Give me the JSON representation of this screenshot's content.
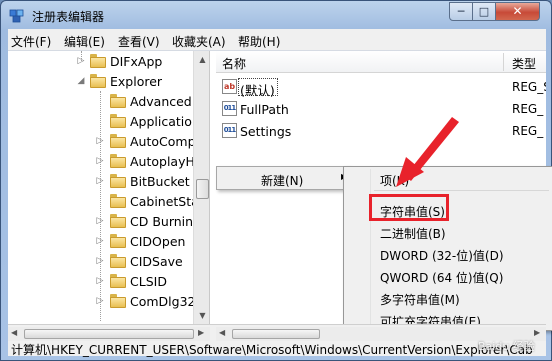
{
  "window": {
    "title": "注册表编辑器",
    "controls": {
      "minimize": "─",
      "maximize": "□",
      "close": "✕"
    }
  },
  "menu": [
    "文件(F)",
    "编辑(E)",
    "查看(V)",
    "收藏夹(A)",
    "帮助(H)"
  ],
  "tree": {
    "items": [
      {
        "label": "DIFxApp",
        "expandable": true
      },
      {
        "label": "Explorer",
        "expandable": true,
        "expanded": true
      },
      {
        "label": "Advanced",
        "expandable": false
      },
      {
        "label": "Application",
        "expandable": false
      },
      {
        "label": "AutoComp",
        "expandable": true
      },
      {
        "label": "AutoplayHa",
        "expandable": true
      },
      {
        "label": "BitBucket",
        "expandable": true
      },
      {
        "label": "CabinetSta",
        "expandable": false,
        "selected": true
      },
      {
        "label": "CD Burning",
        "expandable": true
      },
      {
        "label": "CIDOpen",
        "expandable": true
      },
      {
        "label": "CIDSave",
        "expandable": true
      },
      {
        "label": "CLSID",
        "expandable": true
      },
      {
        "label": "ComDlg32",
        "expandable": true
      }
    ]
  },
  "list": {
    "columns": {
      "name": "名称",
      "type": "类型"
    },
    "rows": [
      {
        "icon": "ab",
        "name": "(默认)",
        "type": "REG_S"
      },
      {
        "icon": "011",
        "name": "FullPath",
        "type": "REG_"
      },
      {
        "icon": "011",
        "name": "Settings",
        "type": "REG_"
      }
    ]
  },
  "context_menu": {
    "new_label": "新建(N)",
    "new_arrow": "▶",
    "submenu": [
      "项(K)",
      "字符串值(S)",
      "二进制值(B)",
      "DWORD (32-位)值(D)",
      "QWORD (64 位)值(Q)",
      "多字符串值(M)",
      "可扩充字符串值(E)"
    ],
    "highlighted_item": "字符串值(S)"
  },
  "status_bar": {
    "path": "计算机\\HKEY_CURRENT_USER\\Software\\Microsoft\\Windows\\CurrentVersion\\Explorer\\Cab"
  },
  "watermark": "Baidu 经验",
  "colors": {
    "annotation_red": "#e8222b",
    "title_gradient": "#bcd3ec",
    "close_button": "#c74a38"
  }
}
